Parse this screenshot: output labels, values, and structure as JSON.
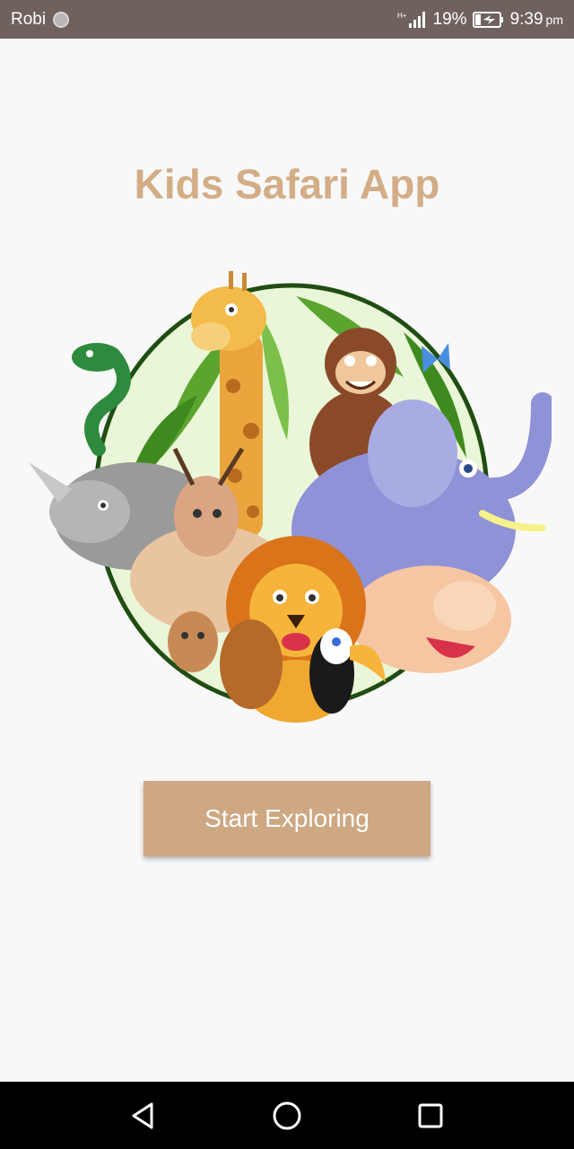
{
  "status_bar": {
    "carrier": "Robi",
    "network": "H+",
    "battery": "19%",
    "time": "9:39",
    "ampm": "pm"
  },
  "main": {
    "title": "Kids Safari App",
    "start_button_label": "Start Exploring"
  },
  "colors": {
    "accent": "#cda882",
    "title": "#d2ad86",
    "status_bar": "#6f625e",
    "nav_bar": "#000000"
  },
  "icons": {
    "nav_back": "triangle-left",
    "nav_home": "circle",
    "nav_recents": "square"
  }
}
